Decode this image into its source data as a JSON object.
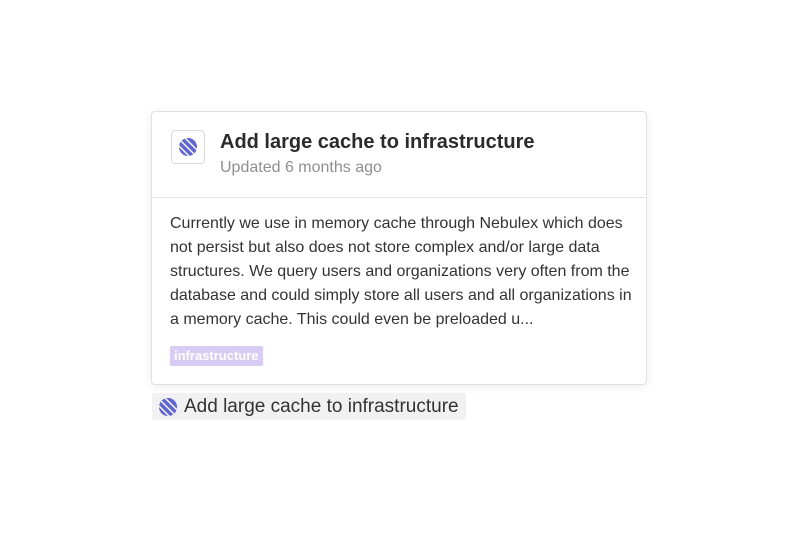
{
  "card": {
    "title": "Add large cache to infrastructure",
    "subtitle": "Updated 6 months ago",
    "description": "Currently we use in memory cache through Nebulex which does not persist but also does not store complex and/or large data structures. We query users and organizations very often from the database and could simply store all users and all organizations in a memory cache. This could even be preloaded u...",
    "tag": "infrastructure",
    "icon": "linear-app-icon"
  },
  "link_chip": {
    "label": "Add large cache to infrastructure",
    "icon": "linear-app-icon"
  },
  "colors": {
    "icon_accent": "#5e63d6",
    "tag_background": "#d8cbf5",
    "tag_text": "#ffffff"
  }
}
